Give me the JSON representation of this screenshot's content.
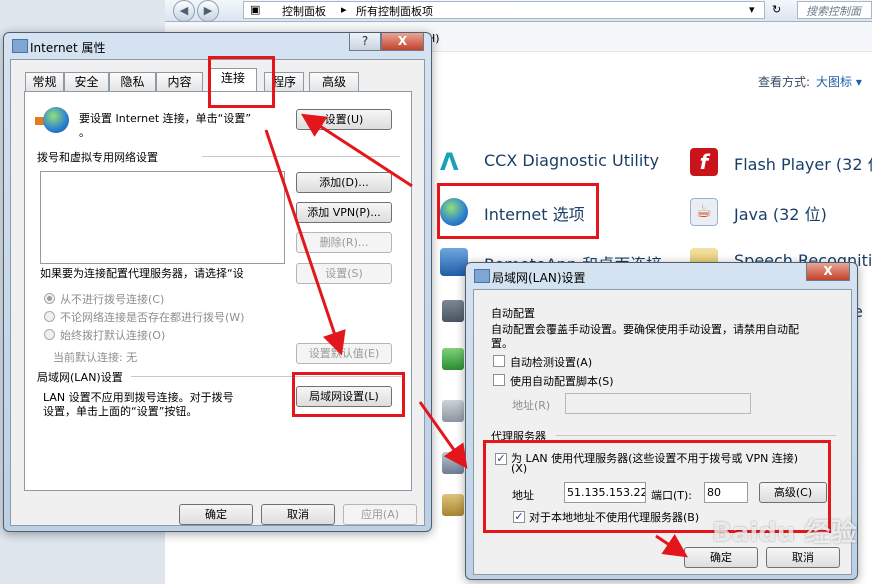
{
  "control_panel": {
    "breadcrumb": [
      "控制面板",
      "所有控制面板项"
    ],
    "search_placeholder": "搜索控制面",
    "menu_hint": "H)",
    "view_by_label": "查看方式:",
    "view_by_value": "大图标 ▾",
    "items": [
      {
        "label": "CCX Diagnostic Utility",
        "icon": "ccx-icon"
      },
      {
        "label": "Flash Player (32 位",
        "icon": "flash-icon"
      },
      {
        "label": "Internet 选项",
        "icon": "internet-options-icon"
      },
      {
        "label": "Java (32 位)",
        "icon": "java-icon"
      },
      {
        "label": "RemoteApp 和桌面连接",
        "icon": "remoteapp-icon"
      },
      {
        "label": "Speech Recogniti",
        "icon": "speech-icon"
      },
      {
        "label": "e",
        "icon": "partial-item-icon"
      }
    ]
  },
  "internet_props": {
    "title": "Internet 属性",
    "help": "?",
    "close": "X",
    "tabs": [
      "常规",
      "安全",
      "隐私",
      "内容",
      "连接",
      "程序",
      "高级"
    ],
    "intro": [
      "要设置 Internet 连接，单击“设置”",
      "。"
    ],
    "setup_btn": "设置(U)",
    "dialup_group": "拨号和虚拟专用网络设置",
    "add_btn": "添加(D)...",
    "add_vpn_btn": "添加 VPN(P)...",
    "remove_btn": "删除(R)...",
    "proxy_note": "如果要为连接配置代理服务器，请选择“设",
    "settings_btn": "设置(S)",
    "radio_never": "从不进行拨号连接(C)",
    "radio_whenever": "不论网络连接是否存在都进行拨号(W)",
    "radio_always": "始终拨打默认连接(O)",
    "current_default": "当前默认连接: 无",
    "set_default_btn": "设置默认值(E)",
    "lan_group": "局域网(LAN)设置",
    "lan_desc": [
      "LAN 设置不应用到拨号连接。对于拨号",
      "设置，单击上面的“设置”按钮。"
    ],
    "lan_btn": "局域网设置(L)",
    "ok": "确定",
    "cancel": "取消",
    "apply": "应用(A)"
  },
  "lan_dialog": {
    "title": "局域网(LAN)设置",
    "close": "X",
    "auto_group": "自动配置",
    "auto_desc": [
      "自动配置会覆盖手动设置。要确保使用手动设置，请禁用自动配",
      "置。"
    ],
    "auto_detect": "自动检测设置(A)",
    "auto_script": "使用自动配置脚本(S)",
    "address_label": "地址(R)",
    "proxy_group": "代理服务器",
    "use_proxy": [
      "为 LAN 使用代理服务器(这些设置不用于拨号或 VPN 连接)",
      "(X)"
    ],
    "addr_label": "地址",
    "addr_value": "51.135.153.22",
    "port_label": "端口(T):",
    "port_value": "80",
    "advanced_btn": "高级(C)",
    "bypass_local": "对于本地地址不使用代理服务器(B)",
    "ok": "确定",
    "cancel": "取消"
  },
  "watermark": "Baidu 经验",
  "colors": {
    "annotation_red": "#e3161b",
    "link_blue": "#1a3f66"
  }
}
